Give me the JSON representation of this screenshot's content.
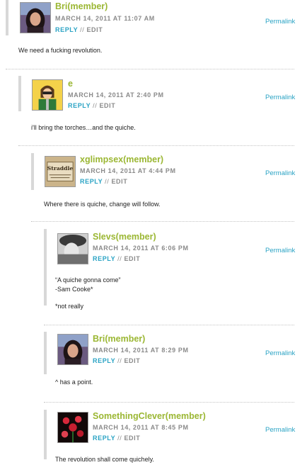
{
  "comments": [
    {
      "author": "Bri(member)",
      "date": "MARCH 14, 2011 AT 11:07 AM",
      "reply": "REPLY",
      "edit": "EDIT",
      "permalink": "Permalink",
      "lines": [
        "We need a fucking revolution."
      ],
      "avatar": "profile-photo"
    },
    {
      "author": "e",
      "date": "MARCH 14, 2011 AT 2:40 PM",
      "reply": "REPLY",
      "edit": "EDIT",
      "permalink": "Permalink",
      "lines": [
        "i'll bring the torches…and the quiche."
      ],
      "avatar": "cartoon-character"
    },
    {
      "author": "xglimpsex(member)",
      "date": "MARCH 14, 2011 AT 4:44 PM",
      "reply": "REPLY",
      "edit": "EDIT",
      "permalink": "Permalink",
      "lines": [
        "Where there is quiche, change will follow."
      ],
      "avatar": "straddle-sign"
    },
    {
      "author": "Slevs(member)",
      "date": "MARCH 14, 2011 AT 6:06 PM",
      "reply": "REPLY",
      "edit": "EDIT",
      "permalink": "Permalink",
      "lines": [
        "“A quiche gonna come”",
        "-Sam Cooke*",
        "",
        "*not really"
      ],
      "avatar": "bw-photo"
    },
    {
      "author": "Bri(member)",
      "date": "MARCH 14, 2011 AT 8:29 PM",
      "reply": "REPLY",
      "edit": "EDIT",
      "permalink": "Permalink",
      "lines": [
        "^ has a point."
      ],
      "avatar": "profile-photo"
    },
    {
      "author": "SomethingClever(member)",
      "date": "MARCH 14, 2011 AT 8:45 PM",
      "reply": "REPLY",
      "edit": "EDIT",
      "permalink": "Permalink",
      "lines": [
        "The revolution shall come quichely."
      ],
      "avatar": "red-flowers"
    }
  ],
  "colors": {
    "author": "#9bb733",
    "link": "#2aa3c4",
    "meta": "#8a8a8a"
  }
}
